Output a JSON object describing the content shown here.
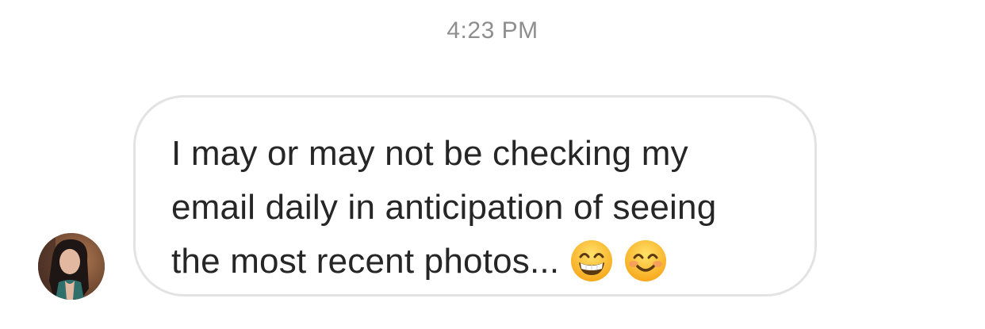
{
  "timestamp": "4:23 PM",
  "message": {
    "lines": [
      "I may or may not be checking my",
      "email daily in anticipation of seeing",
      "the most recent photos..."
    ],
    "emojis": [
      "grinning-face-with-smiling-eyes",
      "smiling-face-with-smiling-eyes"
    ]
  },
  "avatar": {
    "icon": "profile-photo"
  },
  "colors": {
    "timestamp": "#8e8e8e",
    "bubble_border": "#e3e3e3",
    "text": "#262626"
  }
}
